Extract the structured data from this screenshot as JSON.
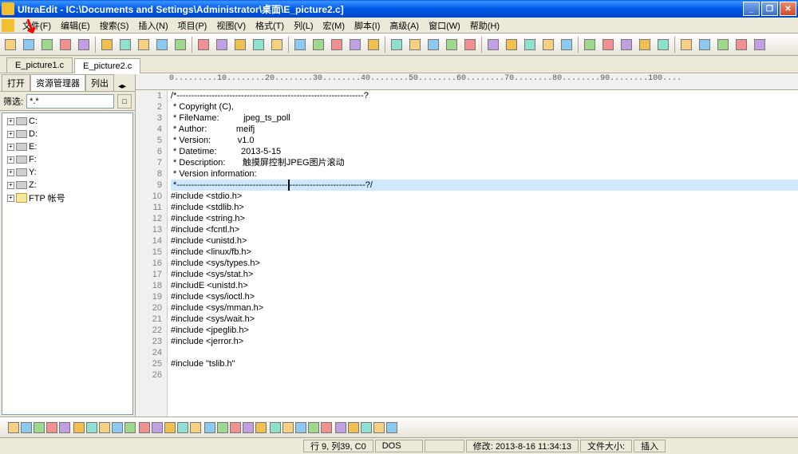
{
  "window": {
    "title": "UltraEdit - IC:\\Documents and Settings\\Administrator\\桌面\\E_picture2.c]"
  },
  "menus": [
    "文件(F)",
    "编辑(E)",
    "搜索(S)",
    "插入(N)",
    "项目(P)",
    "视图(V)",
    "格式(T)",
    "列(L)",
    "宏(M)",
    "脚本(I)",
    "高级(A)",
    "窗口(W)",
    "帮助(H)"
  ],
  "tabs": [
    {
      "label": "E_picture1.c",
      "active": false
    },
    {
      "label": "E_picture2.c",
      "active": true
    }
  ],
  "sidebar": {
    "tabs": [
      "打开",
      "资源管理器",
      "列出"
    ],
    "filter_label": "筛选:",
    "filter_value": "*.*",
    "drives": [
      "C:",
      "D:",
      "E:",
      "F:",
      "Y:",
      "Z:"
    ],
    "ftp_label": "FTP 帐号"
  },
  "ruler_text": "0.........10........20........30........40........50........60........70........80........90........100....",
  "code_lines": [
    {
      "n": 1,
      "t": "/*----------------------------------------------------------------?"
    },
    {
      "n": 2,
      "t": " * Copyright (C),"
    },
    {
      "n": 3,
      "t": " * FileName:          jpeg_ts_poll"
    },
    {
      "n": 4,
      "t": " * Author:            meifj"
    },
    {
      "n": 5,
      "t": " * Version:           v1.0"
    },
    {
      "n": 6,
      "t": " * Datetime:          2013-5-15"
    },
    {
      "n": 7,
      "t": " * Description:       触摸屏控制JPEG图片滚动"
    },
    {
      "n": 8,
      "t": " * Version information:"
    },
    {
      "n": 9,
      "t": " *----------------------------------------------------------------?/",
      "hl": true
    },
    {
      "n": 10,
      "t": "#include <stdio.h>"
    },
    {
      "n": 11,
      "t": "#include <stdlib.h>"
    },
    {
      "n": 12,
      "t": "#include <string.h>"
    },
    {
      "n": 13,
      "t": "#include <fcntl.h>"
    },
    {
      "n": 14,
      "t": "#include <unistd.h>"
    },
    {
      "n": 15,
      "t": "#include <linux/fb.h>"
    },
    {
      "n": 16,
      "t": "#include <sys/types.h>"
    },
    {
      "n": 17,
      "t": "#include <sys/stat.h>"
    },
    {
      "n": 18,
      "t": "#includE <unistd.h>"
    },
    {
      "n": 19,
      "t": "#include <sys/ioctl.h>"
    },
    {
      "n": 20,
      "t": "#include <sys/mman.h>"
    },
    {
      "n": 21,
      "t": "#include <sys/wait.h>"
    },
    {
      "n": 22,
      "t": "#include <jpeglib.h>"
    },
    {
      "n": 23,
      "t": "#include <jerror.h>"
    },
    {
      "n": 24,
      "t": ""
    },
    {
      "n": 25,
      "t": "#include \"tslib.h\""
    },
    {
      "n": 26,
      "t": ""
    }
  ],
  "status": {
    "pos": "行 9, 列39, C0",
    "enc": "DOS",
    "mod": "修改: 2013-8-16 11:34:13",
    "size": "文件大小: ",
    "ins": "插入"
  }
}
